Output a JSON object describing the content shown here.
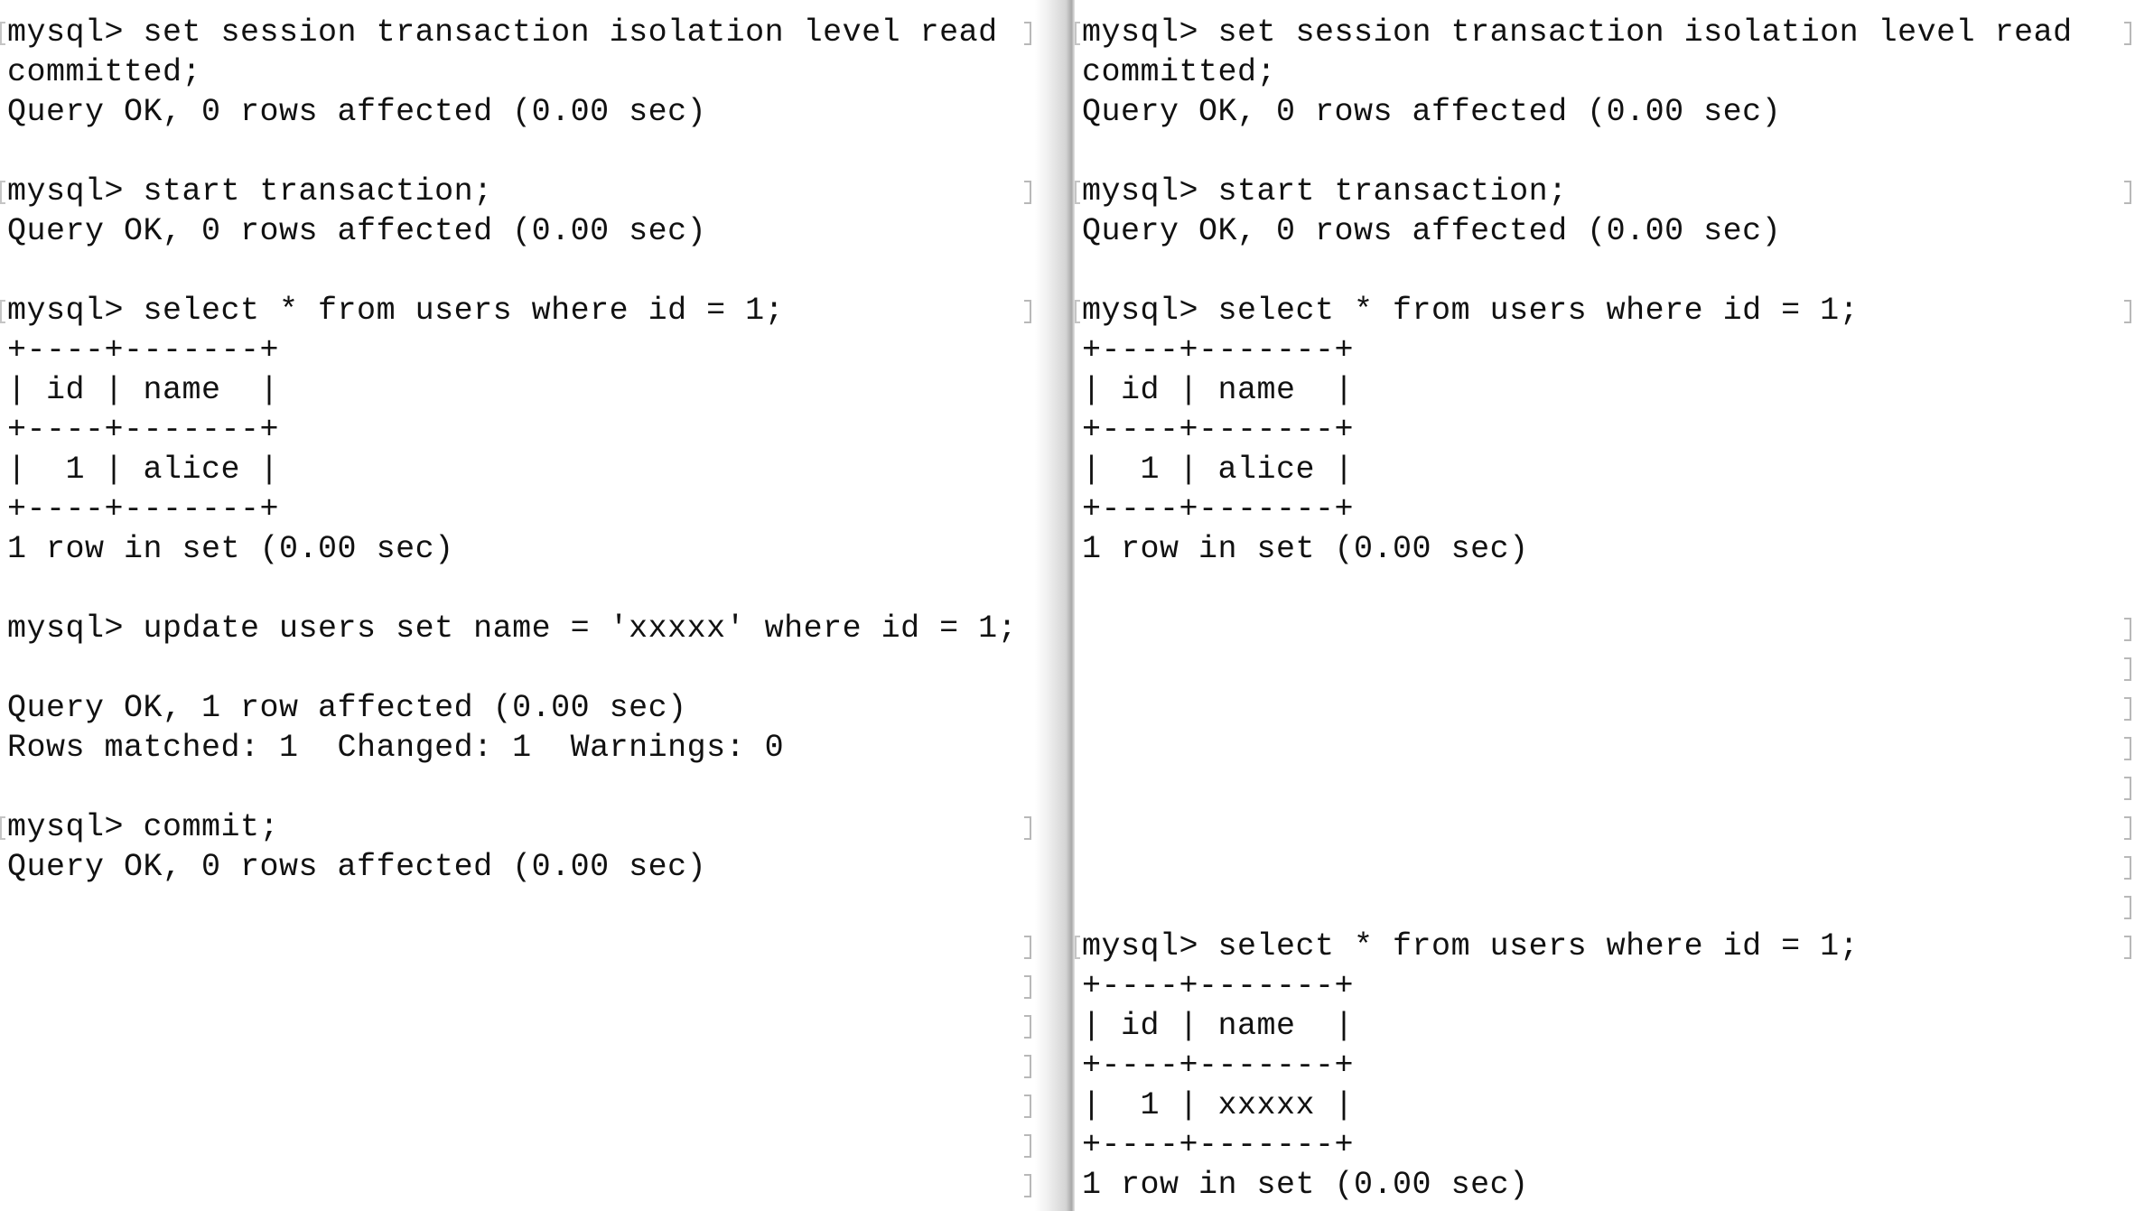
{
  "left_pane": {
    "lines": [
      "mysql> set session transaction isolation level read",
      "committed;",
      "Query OK, 0 rows affected (0.00 sec)",
      "",
      "mysql> start transaction;",
      "Query OK, 0 rows affected (0.00 sec)",
      "",
      "mysql> select * from users where id = 1;",
      "+----+-------+",
      "| id | name  |",
      "+----+-------+",
      "|  1 | alice |",
      "+----+-------+",
      "1 row in set (0.00 sec)",
      "",
      "mysql> update users set name = 'xxxxx' where id = 1;",
      "",
      "Query OK, 1 row affected (0.00 sec)",
      "Rows matched: 1  Changed: 1  Warnings: 0",
      "",
      "mysql> commit;",
      "Query OK, 0 rows affected (0.00 sec)"
    ]
  },
  "right_pane": {
    "lines": [
      "mysql> set session transaction isolation level read",
      "committed;",
      "Query OK, 0 rows affected (0.00 sec)",
      "",
      "mysql> start transaction;",
      "Query OK, 0 rows affected (0.00 sec)",
      "",
      "mysql> select * from users where id = 1;",
      "+----+-------+",
      "| id | name  |",
      "+----+-------+",
      "|  1 | alice |",
      "+----+-------+",
      "1 row in set (0.00 sec)",
      "",
      "",
      "",
      "",
      "",
      "",
      "",
      "",
      "",
      "mysql> select * from users where id = 1;",
      "+----+-------+",
      "| id | name  |",
      "+----+-------+",
      "|  1 | xxxxx |",
      "+----+-------+",
      "1 row in set (0.00 sec)"
    ]
  }
}
